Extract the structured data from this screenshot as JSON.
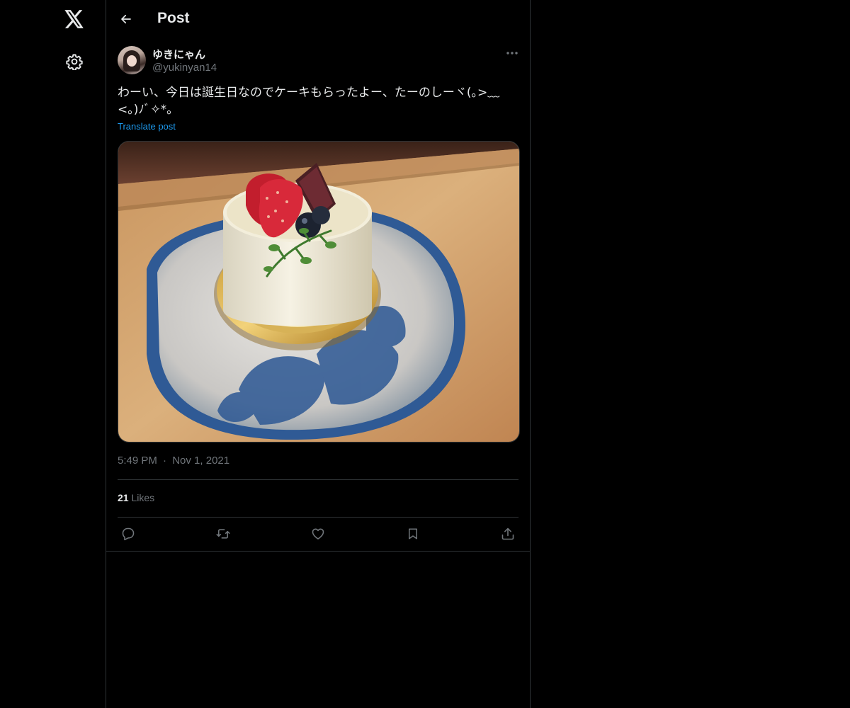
{
  "header": {
    "title": "Post"
  },
  "nav": {
    "logo_icon": "x-logo-icon",
    "settings_icon": "gear-icon"
  },
  "post": {
    "display_name": "ゆきにゃん",
    "handle": "@yukinyan14",
    "text": "わーい、今日は誕生日なのでケーキもらったよー、たーのしーヾ(｡>﹏<｡)ﾉﾞ✧*。",
    "translate_label": "Translate post",
    "time": "5:49 PM",
    "separator": "·",
    "date": "Nov 1, 2021",
    "likes_count": "21",
    "likes_label": "Likes"
  },
  "actions": {
    "reply_icon": "reply-icon",
    "repost_icon": "repost-icon",
    "like_icon": "heart-icon",
    "bookmark_icon": "bookmark-icon",
    "share_icon": "share-icon"
  },
  "colors": {
    "background": "#000000",
    "text": "#e7e9ea",
    "muted": "#71767b",
    "link": "#1d9bf0",
    "border": "#2f3336"
  }
}
